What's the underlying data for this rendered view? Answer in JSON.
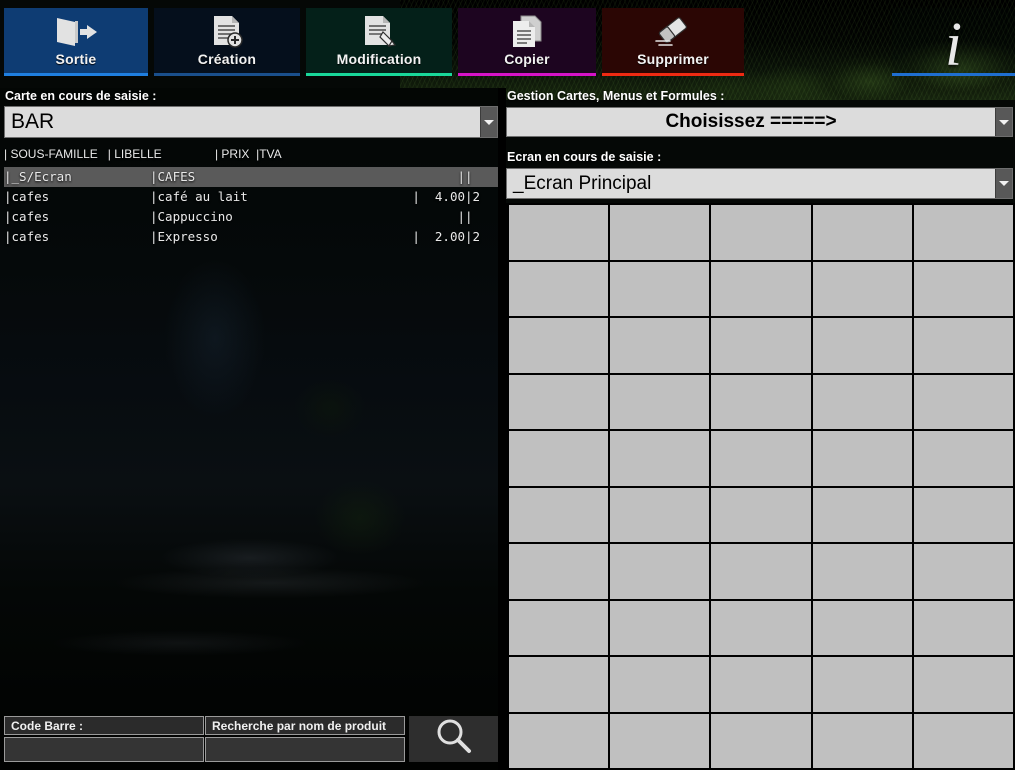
{
  "toolbar": {
    "buttons": [
      {
        "id": "sortie",
        "label": "Sortie",
        "icon": "exit-door-icon",
        "accent": "#1f7fe0",
        "bg": "#0e3c73"
      },
      {
        "id": "creation",
        "label": "Création",
        "icon": "document-add-icon",
        "accent": "#1a4f8c",
        "bg": "#050f1c"
      },
      {
        "id": "modification",
        "label": "Modification",
        "icon": "document-edit-icon",
        "accent": "#19d89a",
        "bg": "#042019"
      },
      {
        "id": "copier",
        "label": "Copier",
        "icon": "document-copy-icon",
        "accent": "#d613c8",
        "bg": "#1d0520"
      },
      {
        "id": "supprimer",
        "label": "Supprimer",
        "icon": "eraser-icon",
        "accent": "#ef2a12",
        "bg": "#2b0604"
      }
    ],
    "info": {
      "glyph": "i",
      "icon": "info-icon",
      "accent": "#1f6fd0"
    }
  },
  "left_panel": {
    "carte_label": "Carte en cours de saisie :",
    "carte_value": "BAR",
    "list_header": "| SOUS-FAMILLE   | LIBELLE                | PRIX  |TVA",
    "columns": [
      "SOUS-FAMILLE",
      "LIBELLE",
      "PRIX",
      "TVA"
    ],
    "rows": [
      {
        "famille": "|_S/Ecran",
        "libelle": "|CAFES",
        "prix": "|",
        "tva": "|",
        "selected": true
      },
      {
        "famille": "|cafes",
        "libelle": "|café au lait",
        "prix": "|  4.00",
        "tva": "|2",
        "selected": false
      },
      {
        "famille": "|cafes",
        "libelle": "|Cappuccino",
        "prix": "|",
        "tva": "|",
        "selected": false
      },
      {
        "famille": "|cafes",
        "libelle": "|Expresso",
        "prix": "|  2.00",
        "tva": "|2",
        "selected": false
      }
    ],
    "search": {
      "codebarre_label": "Code Barre :",
      "codebarre_value": "",
      "produit_label": "Recherche par nom de produit",
      "produit_value": "",
      "button_icon": "magnifier-icon"
    }
  },
  "right_panel": {
    "gestion_label": "Gestion Cartes, Menus et Formules  :",
    "gestion_value": "Choisissez  =====>",
    "ecran_label": "Ecran en cours de saisie :",
    "ecran_value": "_Ecran Principal",
    "grid": {
      "columns": 5,
      "rows": 10,
      "cell_color": "#c0c0c0",
      "cells": [
        "",
        "",
        "",
        "",
        "",
        "",
        "",
        "",
        "",
        "",
        "",
        "",
        "",
        "",
        "",
        "",
        "",
        "",
        "",
        "",
        "",
        "",
        "",
        "",
        "",
        "",
        "",
        "",
        "",
        "",
        "",
        "",
        "",
        "",
        "",
        "",
        "",
        "",
        "",
        "",
        "",
        "",
        "",
        "",
        "",
        "",
        "",
        "",
        "",
        ""
      ]
    }
  }
}
